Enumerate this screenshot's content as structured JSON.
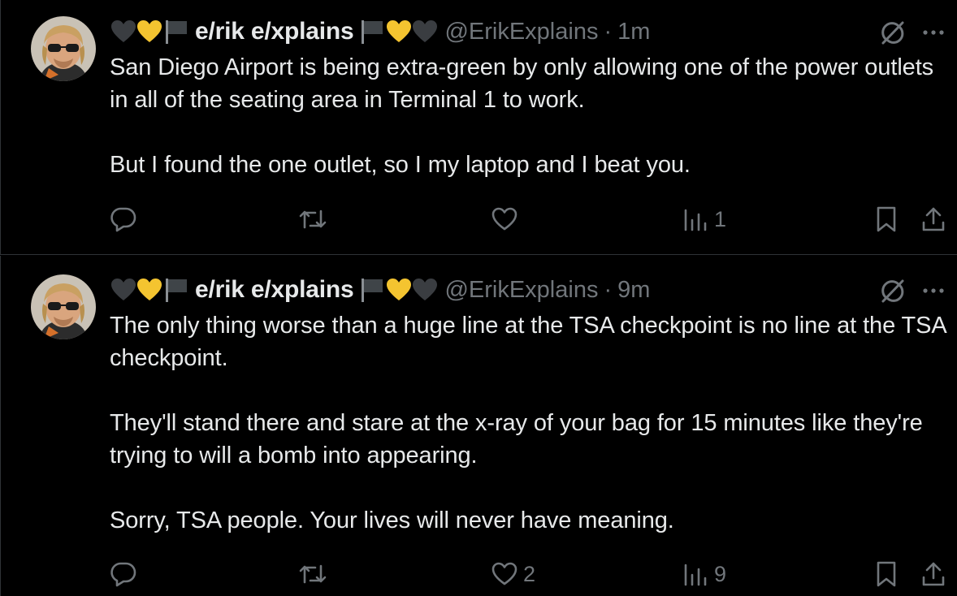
{
  "colors": {
    "background": "#000000",
    "primary_text": "#e7e9ea",
    "secondary_text": "#71767b",
    "divider": "#2f3336",
    "yellow_heart": "#f4c430",
    "black_heart": "#3a3d41",
    "flag": "#3f4448"
  },
  "tweets": [
    {
      "author": {
        "display_name": "e/rik e/xplains",
        "handle": "@ErikExplains",
        "leading_emoji": [
          "black-heart-icon",
          "yellow-heart-icon",
          "black-flag-icon"
        ],
        "trailing_emoji": [
          "black-flag-icon",
          "yellow-heart-icon",
          "black-heart-icon"
        ]
      },
      "separator": "·",
      "time": "1m",
      "paragraphs": [
        "San Diego Airport is being extra-green by only allowing one of the power outlets in all of the seating area in Terminal 1 to work.",
        "But I found the one outlet, so I my laptop and I beat you."
      ],
      "actions": {
        "reply_count": "",
        "retweet_count": "",
        "like_count": "",
        "views_count": "1"
      }
    },
    {
      "author": {
        "display_name": "e/rik e/xplains",
        "handle": "@ErikExplains",
        "leading_emoji": [
          "black-heart-icon",
          "yellow-heart-icon",
          "black-flag-icon"
        ],
        "trailing_emoji": [
          "black-flag-icon",
          "yellow-heart-icon",
          "black-heart-icon"
        ]
      },
      "separator": "·",
      "time": "9m",
      "paragraphs": [
        "The only thing worse than a huge line at the TSA checkpoint is no line at the TSA checkpoint.",
        "They'll stand there and stare at the x-ray of your bag for 15 minutes like they're trying to will a bomb into appearing.",
        "Sorry, TSA people. Your lives will never have meaning."
      ],
      "actions": {
        "reply_count": "",
        "retweet_count": "",
        "like_count": "2",
        "views_count": "9"
      }
    }
  ]
}
